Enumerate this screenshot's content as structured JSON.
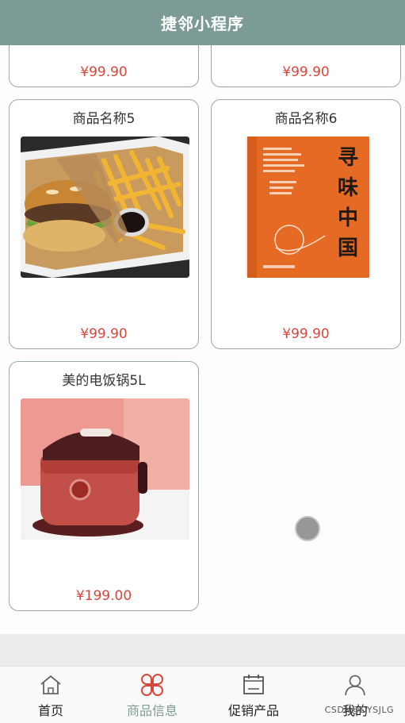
{
  "header": {
    "title": "捷邻小程序"
  },
  "products_partial": [
    {
      "price": "¥99.90"
    },
    {
      "price": "¥99.90"
    }
  ],
  "products": [
    {
      "name": "商品名称5",
      "price": "¥99.90",
      "image": "burger-fries-photo"
    },
    {
      "name": "商品名称6",
      "price": "¥99.90",
      "image": "cookbook-cover",
      "cover_title": "寻味中国"
    },
    {
      "name": "美的电饭锅5L",
      "price": "¥199.00",
      "image": "rice-cooker-photo"
    }
  ],
  "tabbar": {
    "active": "商品信息",
    "items": [
      {
        "label": "首页",
        "icon": "home-icon"
      },
      {
        "label": "商品信息",
        "icon": "clover-grid-icon"
      },
      {
        "label": "促销产品",
        "icon": "calendar-icon"
      },
      {
        "label": "我的",
        "icon": "user-icon"
      }
    ]
  },
  "watermark": "CSDN@DYSJLG",
  "colors": {
    "header": "#7c9b97",
    "price": "#d9463b",
    "active_tab": "#7c9b97"
  }
}
